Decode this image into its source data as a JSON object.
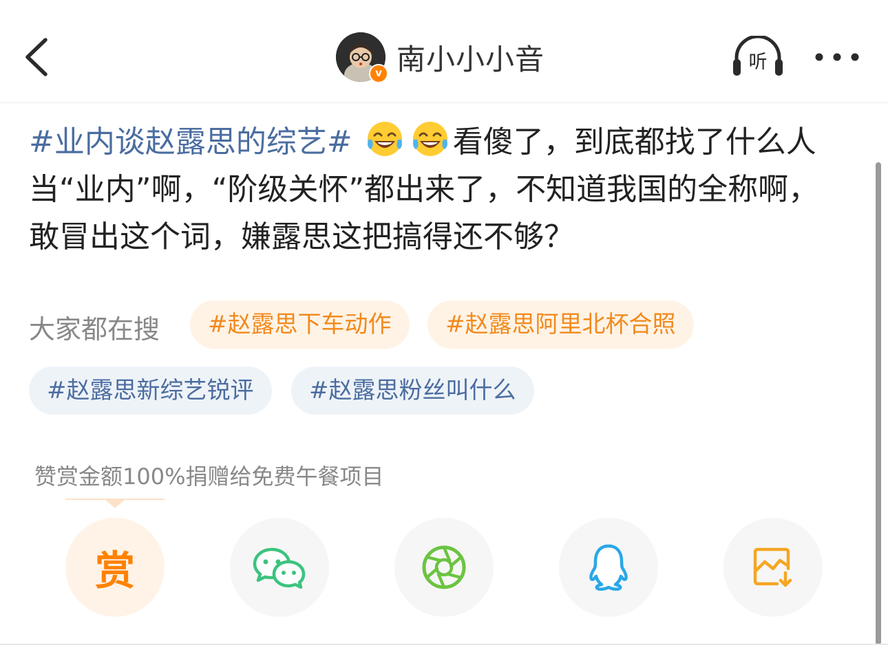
{
  "header": {
    "author_name": "南小小小音",
    "verified_badge": "v",
    "listen_label": "听"
  },
  "post": {
    "topic": "#业内谈赵露思的综艺#",
    "emoji_name": "laughing-with-tears",
    "body": "看傻了，到底都找了什么人当“业内”啊，“阶级关怀”都出来了，不知道我国的全称啊，敢冒出这个词，嫌露思这把搞得还不够？"
  },
  "search": {
    "label": "大家都在搜",
    "chips": [
      {
        "text": "#赵露思下车动作",
        "color": "orange"
      },
      {
        "text": "#赵露思阿里北杯合照",
        "color": "orange"
      },
      {
        "text": "#赵露思新综艺锐评",
        "color": "blue"
      },
      {
        "text": "#赵露思粉丝叫什么",
        "color": "blue"
      }
    ]
  },
  "reward": {
    "note": "赞赏金额100%捐赠给免费午餐项目",
    "button_char": "赏"
  },
  "share": [
    {
      "name": "reward",
      "icon": "reward-icon"
    },
    {
      "name": "wechat",
      "icon": "wechat-icon"
    },
    {
      "name": "moments",
      "icon": "moments-aperture-icon"
    },
    {
      "name": "qq",
      "icon": "qq-penguin-icon"
    },
    {
      "name": "save-image",
      "icon": "save-image-icon"
    }
  ],
  "colors": {
    "brand_orange": "#ff8200",
    "topic_blue": "#4b6da0",
    "wechat_green": "#3cc37e",
    "moments_green": "#6bc441",
    "qq_blue": "#2aa7e8",
    "save_orange": "#f5a623"
  }
}
